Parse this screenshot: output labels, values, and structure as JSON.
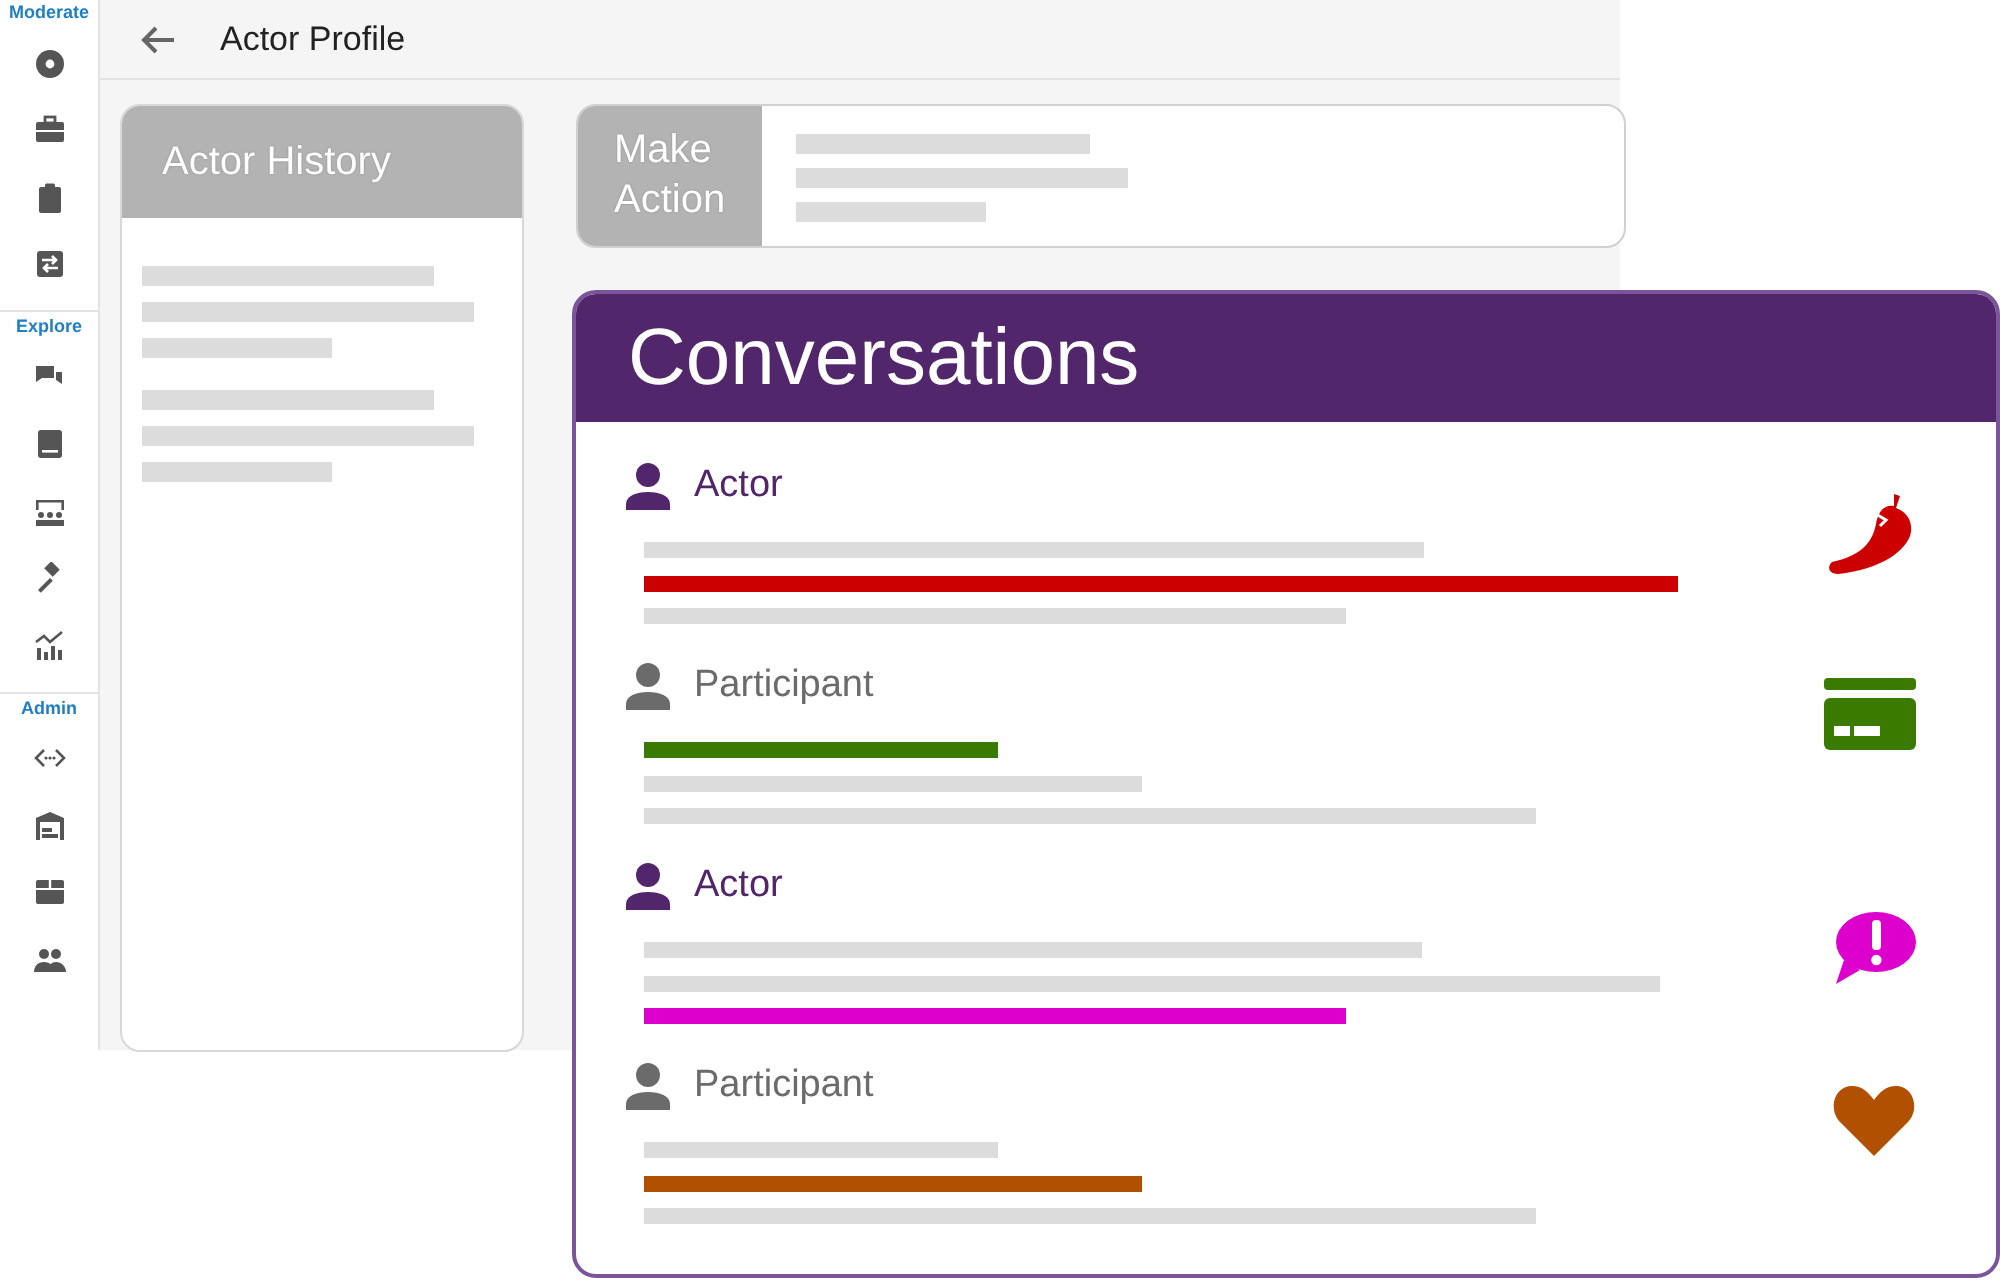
{
  "sidebar": {
    "sections": [
      {
        "title": "Moderate"
      },
      {
        "title": "Explore"
      },
      {
        "title": "Admin"
      }
    ]
  },
  "header": {
    "title": "Actor Profile"
  },
  "history_card": {
    "title": "Actor History"
  },
  "action_card": {
    "title": "Make Action"
  },
  "conversations": {
    "title": "Conversations",
    "messages": [
      {
        "kind": "actor",
        "label": "Actor",
        "color": "#cc0000",
        "lines": [
          {
            "kind": "plain"
          },
          {
            "kind": "highlight"
          },
          {
            "kind": "plain"
          }
        ]
      },
      {
        "kind": "participant",
        "label": "Participant",
        "color": "#3a7a00",
        "lines": [
          {
            "kind": "highlight"
          },
          {
            "kind": "plain"
          },
          {
            "kind": "plain"
          }
        ]
      },
      {
        "kind": "actor",
        "label": "Actor",
        "color": "#dd00cc",
        "lines": [
          {
            "kind": "plain"
          },
          {
            "kind": "plain"
          },
          {
            "kind": "highlight"
          }
        ]
      },
      {
        "kind": "participant",
        "label": "Participant",
        "color": "#b05000",
        "lines": [
          {
            "kind": "plain"
          },
          {
            "kind": "highlight"
          },
          {
            "kind": "plain"
          }
        ]
      }
    ]
  }
}
